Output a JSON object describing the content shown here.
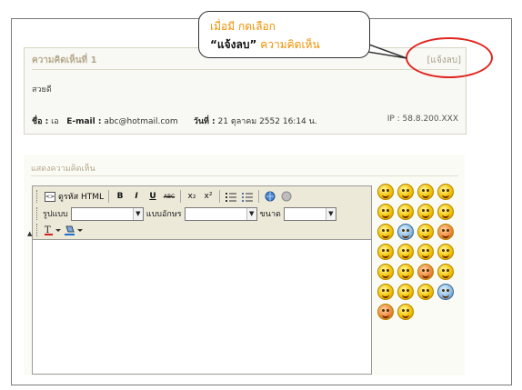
{
  "comment": {
    "title": "ความคิดเห็นที่ 1",
    "report_link": "[แจ้งลบ]",
    "body": "สวยดี",
    "name_label": "ชื่อ :",
    "name_value": "เอ",
    "email_label": "E-mail :",
    "email_value": "abc@hotmail.com",
    "date_label": "วันที่ :",
    "date_value": "21 ตุลาคม 2552 16:14 น.",
    "ip": "IP : 58.8.200.XXX"
  },
  "callout": {
    "line1": "เมื่อมี กดเลือก",
    "line2_quoted": "“แจ้งลบ”",
    "line2_rest": "ความคิดเห็น",
    "color": "#f09000"
  },
  "form": {
    "section_label": "แสดงความคิดเห็น",
    "toolbar": {
      "source_label": "ดูรหัส HTML",
      "bold": "B",
      "italic": "I",
      "underline": "U",
      "strike": "ABC",
      "subscript": "x₂",
      "superscript": "x²",
      "format_label": "รูปแบบ",
      "font_label": "แบบอักษร",
      "size_label": "ขนาด",
      "format_value": "",
      "font_value": "",
      "size_value": ""
    },
    "emoticons": [
      "smile",
      "laugh",
      "wink",
      "shy",
      "grin",
      "sweat",
      "love",
      "tongue",
      "sad",
      "cool",
      "cry",
      "angry",
      "shock",
      "sleep",
      "confused",
      "kiss",
      "embarrassed",
      "happy",
      "devil",
      "sick",
      "sing",
      "crazy",
      "nerd",
      "hat",
      "mad",
      "dizzy"
    ]
  },
  "colors": {
    "highlight_circle": "#e0261f",
    "label_text": "#b6a98c"
  }
}
